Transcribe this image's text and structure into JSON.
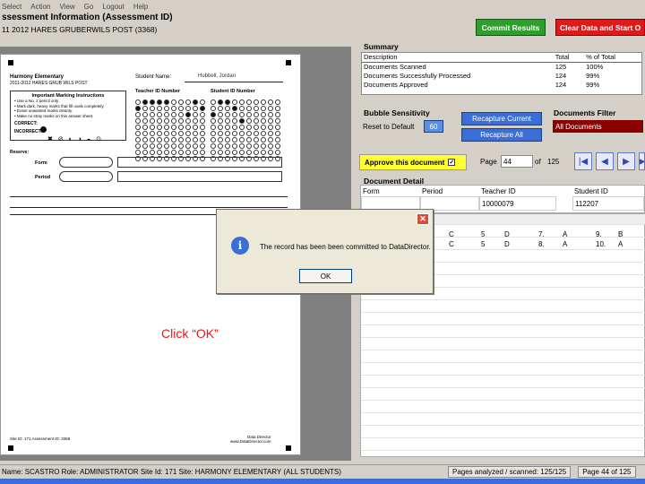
{
  "menu": [
    "Select",
    "Action",
    "View",
    "Go",
    "Logout",
    "Help"
  ],
  "header": {
    "title": "ssessment Information (Assessment ID)",
    "subtitle": "11 2012 HARES GRUBERWILS POST (3368)"
  },
  "buttons": {
    "commit": "Commit Results",
    "clear": "Clear Data and Start O"
  },
  "document": {
    "school": "Harmony Elementary",
    "test_line": "2011-2012 HARES GRUB WILS POST",
    "student_name_label": "Student Name:",
    "student_name_value": "Hubbell, Jordan",
    "teacher_id_label": "Teacher ID Number",
    "student_id_label": "Student ID Number",
    "instructions_title": "Important Marking Instructions",
    "instructions": [
      "• Use a No. 2 pencil only.",
      "• Mark dark, heavy marks that fill ovals completely.",
      "• Erase unwanted marks cleanly.",
      "• Make no stray marks on this answer sheet."
    ],
    "correct_label": "CORRECT:",
    "incorrect_label": "INCORRECT:",
    "reserve_label": "Reserve:",
    "form_label": "Form",
    "period_label": "Period",
    "footer_left": "Site ID: 171  Assessment ID: 3368",
    "footer_right": "Data Director\nwww.DataDirector.com"
  },
  "summary": {
    "title": "Summary",
    "headers": [
      "Description",
      "Total",
      "% of Total"
    ],
    "rows": [
      [
        "Documents Scanned",
        "125",
        "100%"
      ],
      [
        "Documents Successfully Processed",
        "124",
        "99%"
      ],
      [
        "Documents Approved",
        "124",
        "99%"
      ]
    ]
  },
  "bubble": {
    "title": "Bubble Sensitivity",
    "reset_label": "Reset to Default",
    "value": "60",
    "recapture_current": "Recapture Current",
    "recapture_all": "Recapture All"
  },
  "filter": {
    "title": "Documents Filter",
    "value": "All Documents"
  },
  "approve": {
    "label": "Approve this document",
    "check": "✓"
  },
  "pager": {
    "page_label": "Page",
    "page_value": "44",
    "of_label": "of",
    "total": "125"
  },
  "detail": {
    "title": "Document Detail",
    "headers": [
      "Form",
      "Period",
      "Teacher ID",
      "Student ID"
    ],
    "teacher_id": "10000079",
    "student_id": "112207"
  },
  "answers": [
    [
      "C",
      "5",
      "D",
      "7.",
      "A",
      "9.",
      "B"
    ],
    [
      "C",
      "5",
      "D",
      "8.",
      "A",
      "10.",
      "A"
    ]
  ],
  "dialog": {
    "message": "The record has been been committed to DataDirector.",
    "ok": "OK"
  },
  "annotation": "Click “OK”",
  "status": {
    "user": "Name: SCASTRO  Role: ADMINISTRATOR  Site Id: 171  Site: HARMONY ELEMENTARY (ALL STUDENTS)",
    "pages": "Pages analyzed / scanned: 125/125",
    "page_of": "Page 44 of 125"
  }
}
